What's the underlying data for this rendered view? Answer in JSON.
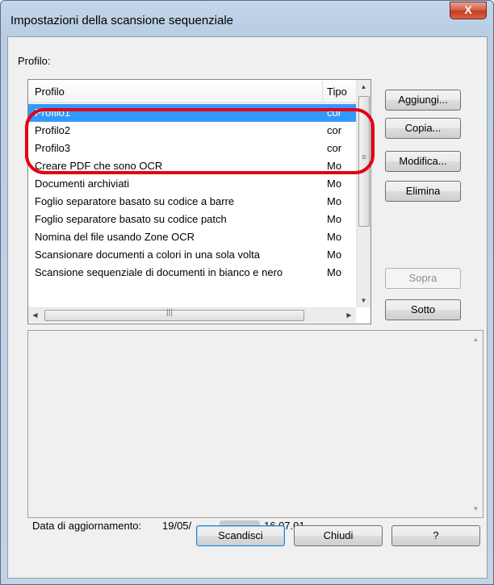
{
  "window": {
    "title": "Impostazioni della scansione sequenziale",
    "close_glyph": "X"
  },
  "profile_label": "Profilo:",
  "list": {
    "columns": [
      "Profilo",
      "Tipo"
    ],
    "rows": [
      {
        "name": "Profilo1",
        "type": "cor",
        "selected": true
      },
      {
        "name": "Profilo2",
        "type": "cor"
      },
      {
        "name": "Profilo3",
        "type": "cor"
      },
      {
        "name": "Creare PDF che sono OCR",
        "type": "Mo"
      },
      {
        "name": "Documenti archiviati",
        "type": "Mo"
      },
      {
        "name": "Foglio separatore basato su codice a barre",
        "type": "Mo"
      },
      {
        "name": "Foglio separatore basato su codice patch",
        "type": "Mo"
      },
      {
        "name": "Nomina del file usando Zone OCR",
        "type": "Mo"
      },
      {
        "name": "Scansionare documenti a colori in una sola volta",
        "type": "Mo"
      },
      {
        "name": "Scansione sequenziale di documenti in bianco e nero",
        "type": "Mo"
      }
    ]
  },
  "buttons": {
    "add": "Aggiungi...",
    "copy": "Copia...",
    "edit": "Modifica...",
    "delete": "Elimina",
    "up": "Sopra",
    "down": "Sotto"
  },
  "update": {
    "label": "Data di aggiornamento:",
    "date": "19/05/",
    "time": "16.07.01"
  },
  "footer": {
    "scan": "Scandisci",
    "close": "Chiudi",
    "help": "?"
  },
  "colors": {
    "selection": "#3399ff",
    "highlight": "#e4000f"
  }
}
